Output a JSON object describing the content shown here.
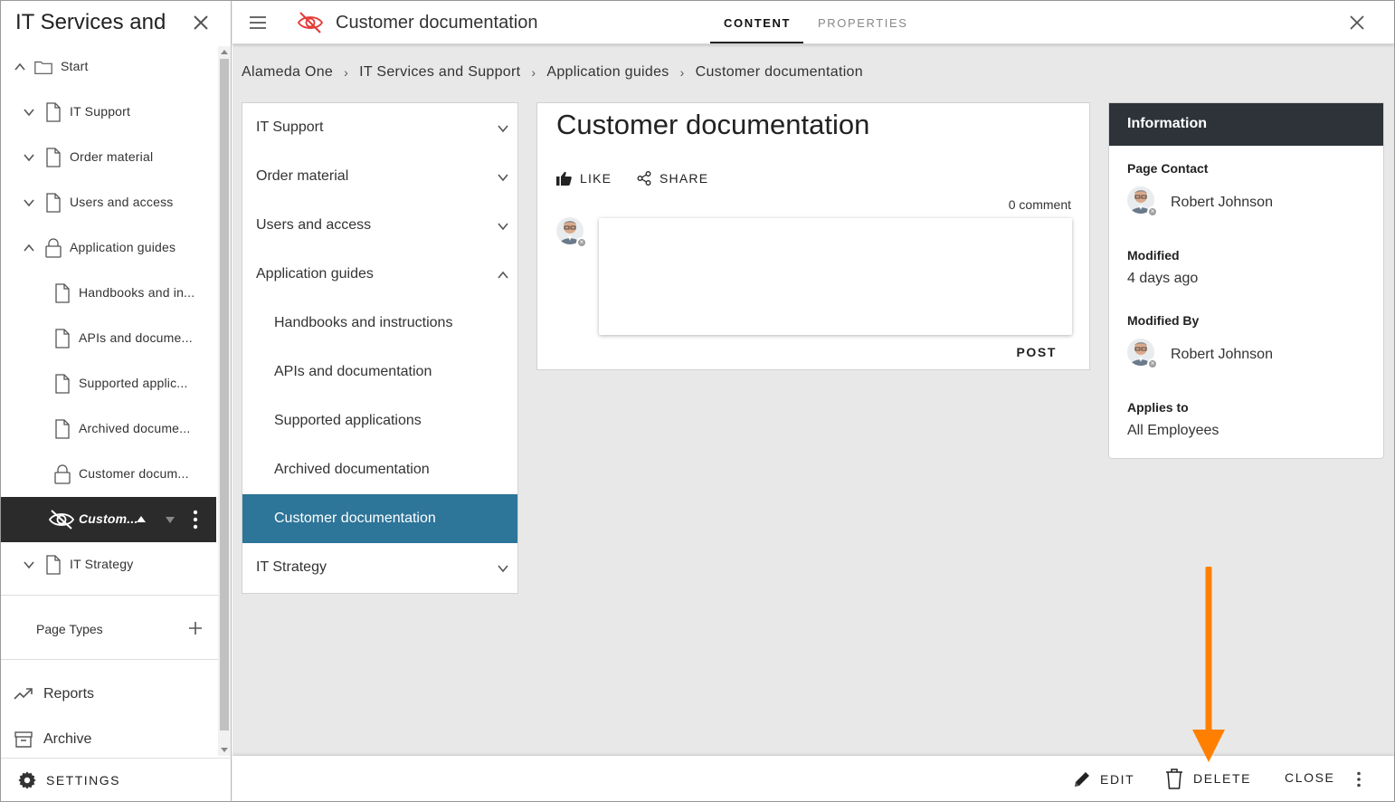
{
  "sidebar": {
    "title": "IT Services and Support",
    "tree": [
      {
        "label": "Start",
        "icon": "folder-icon",
        "chevron": "up",
        "level": 0
      },
      {
        "label": "IT Support",
        "icon": "document-icon",
        "chevron": "down",
        "level": 1
      },
      {
        "label": "Order material",
        "icon": "document-icon",
        "chevron": "down",
        "level": 1
      },
      {
        "label": "Users and access",
        "icon": "document-icon",
        "chevron": "down",
        "level": 1
      },
      {
        "label": "Application guides",
        "icon": "lock-icon",
        "chevron": "up",
        "level": 1
      },
      {
        "label": "Handbooks and in...",
        "icon": "document-icon",
        "level": 2
      },
      {
        "label": "APIs and docume...",
        "icon": "document-icon",
        "level": 2
      },
      {
        "label": "Supported applic...",
        "icon": "document-icon",
        "level": 2
      },
      {
        "label": "Archived docume...",
        "icon": "document-icon",
        "level": 2
      },
      {
        "label": "Customer docum...",
        "icon": "lock-icon",
        "level": 2
      },
      {
        "label": "Custom...",
        "icon": "hidden-eye-icon",
        "level": 2,
        "active": true
      },
      {
        "label": "IT Strategy",
        "icon": "document-icon",
        "chevron": "down",
        "level": 1
      }
    ],
    "page_types": "Page Types",
    "links": [
      {
        "label": "Reports",
        "icon": "trending-up-icon"
      },
      {
        "label": "Archive",
        "icon": "archive-icon"
      }
    ],
    "settings": "SETTINGS"
  },
  "topbar": {
    "title": "Customer documentation",
    "tabs": [
      {
        "label": "CONTENT",
        "active": true
      },
      {
        "label": "PROPERTIES",
        "active": false
      }
    ]
  },
  "breadcrumb": [
    "Alameda One",
    "IT Services and Support",
    "Application guides",
    "Customer documentation"
  ],
  "nav": [
    {
      "label": "IT Support",
      "chevron": "down"
    },
    {
      "label": "Order material",
      "chevron": "down"
    },
    {
      "label": "Users and access",
      "chevron": "down"
    },
    {
      "label": "Application guides",
      "chevron": "up"
    },
    {
      "label": "Handbooks and instructions",
      "sub": true
    },
    {
      "label": "APIs and documentation",
      "sub": true
    },
    {
      "label": "Supported applications",
      "sub": true
    },
    {
      "label": "Archived documentation",
      "sub": true
    },
    {
      "label": "Customer documentation",
      "sub": true,
      "selected": true
    },
    {
      "label": "IT Strategy",
      "chevron": "down"
    }
  ],
  "content": {
    "title": "Customer documentation",
    "like": "LIKE",
    "share": "SHARE",
    "comment_count": "0 comment",
    "post": "POST"
  },
  "info": {
    "heading": "Information",
    "page_contact_label": "Page Contact",
    "page_contact": "Robert Johnson",
    "modified_label": "Modified",
    "modified": "4 days ago",
    "modified_by_label": "Modified By",
    "modified_by": "Robert Johnson",
    "applies_to_label": "Applies to",
    "applies_to": "All Employees"
  },
  "bottombar": {
    "edit": "EDIT",
    "delete": "DELETE",
    "close": "CLOSE"
  },
  "colors": {
    "selected_nav": "#2d7599",
    "info_header": "#2d3338",
    "active_tree": "#2b2b2b",
    "annotation_arrow": "#ff8000",
    "hidden_icon": "#e53935"
  }
}
